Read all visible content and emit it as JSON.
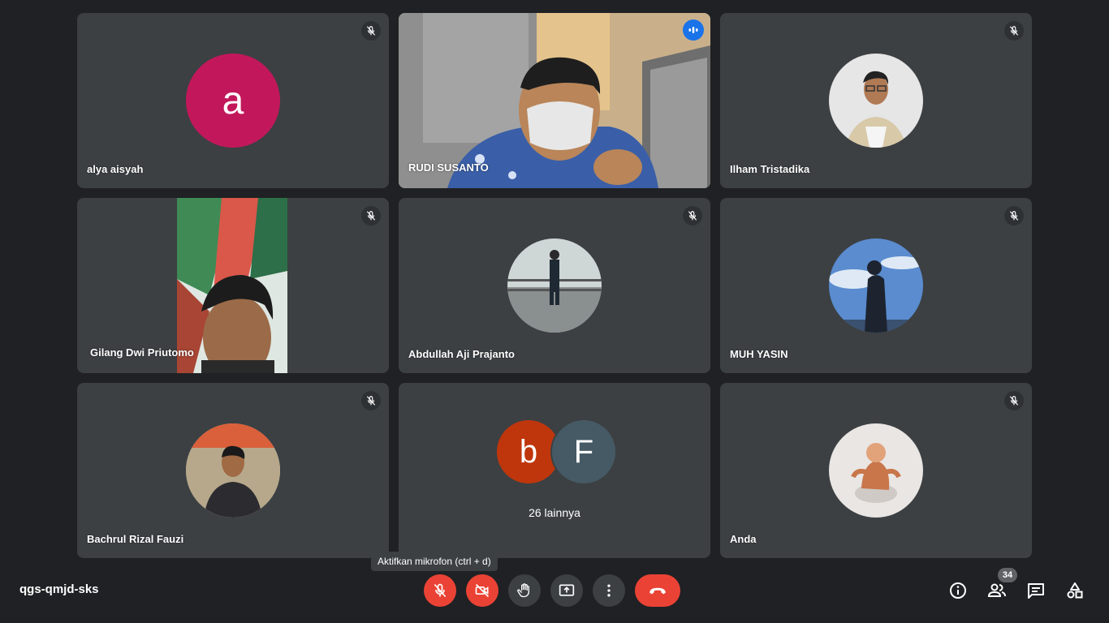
{
  "meeting": {
    "code": "qgs-qmjd-sks"
  },
  "tooltip": {
    "mic": "Aktifkan mikrofon (ctrl + d)"
  },
  "participants": [
    {
      "name": "alya aisyah",
      "avatar_letter": "a",
      "avatar_color": "#c2185b",
      "muted": true
    },
    {
      "name": "RUDI SUSANTO",
      "video_on": true,
      "speaking": true
    },
    {
      "name": "Ilham Tristadika",
      "muted": true
    },
    {
      "name": "Gilang Dwi Priutomo",
      "video_on": true,
      "muted": true
    },
    {
      "name": "Abdullah Aji Prajanto",
      "muted": true
    },
    {
      "name": "MUH YASIN",
      "muted": true
    },
    {
      "name": "Bachrul Rizal Fauzi",
      "muted": true
    },
    {
      "name": "Anda",
      "muted": true
    }
  ],
  "others": {
    "label": "26 lainnya",
    "avatars": [
      {
        "letter": "b",
        "color": "#bf360c"
      },
      {
        "letter": "F",
        "color": "#455a64"
      }
    ]
  },
  "people_count": "34",
  "colors": {
    "background": "#202124",
    "tile": "#3c4043",
    "danger": "#ea4335",
    "active_border": "#8ab4f8",
    "speaking": "#1a73e8"
  },
  "icons": [
    "mic-off-icon",
    "video-off-icon",
    "hand-icon",
    "present-icon",
    "more-vert-icon",
    "call-end-icon",
    "info-icon",
    "people-icon",
    "chat-icon",
    "activities-icon",
    "speaking-icon"
  ]
}
